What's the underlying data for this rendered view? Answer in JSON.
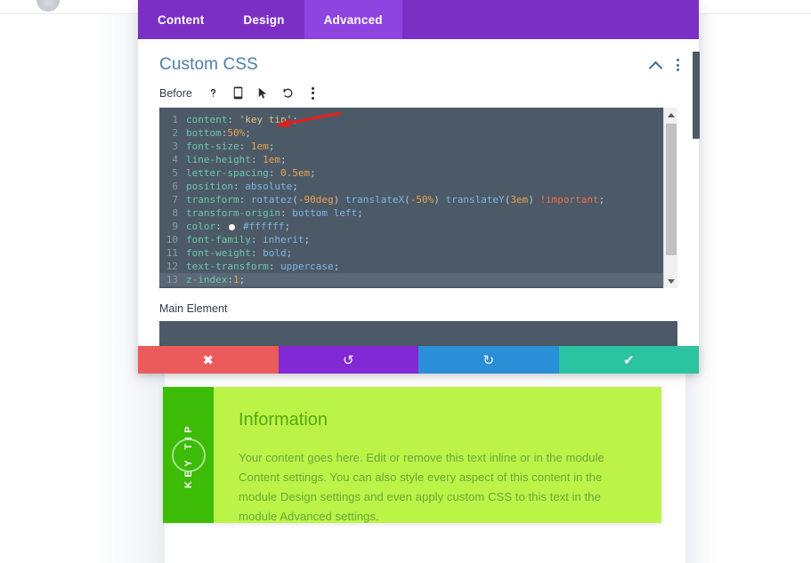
{
  "panel": {
    "tabs": [
      {
        "label": "Content",
        "active": false
      },
      {
        "label": "Design",
        "active": false
      },
      {
        "label": "Advanced",
        "active": true
      }
    ],
    "section_title": "Custom CSS",
    "collapse_icon": "chevron-up-icon",
    "menu_icon": "kebab-menu-icon"
  },
  "toolbar": {
    "label": "Before",
    "icons": [
      {
        "name": "help-icon",
        "glyph": "?"
      },
      {
        "name": "device-mobile-icon",
        "glyph": "⎕"
      },
      {
        "name": "cursor-pointer-icon",
        "glyph": "↖"
      },
      {
        "name": "reset-undo-icon",
        "glyph": "↺"
      },
      {
        "name": "kebab-menu-icon",
        "glyph": "⋮"
      }
    ]
  },
  "editor": {
    "lines": [
      {
        "n": "1",
        "segments": [
          {
            "t": "prop",
            "v": "content"
          },
          {
            "t": "punc",
            "v": ": "
          },
          {
            "t": "str",
            "v": "'key tip'"
          },
          {
            "t": "punc",
            "v": ";"
          }
        ]
      },
      {
        "n": "2",
        "segments": [
          {
            "t": "prop",
            "v": "bottom"
          },
          {
            "t": "punc",
            "v": ":"
          },
          {
            "t": "num",
            "v": "50%"
          },
          {
            "t": "punc",
            "v": ";"
          }
        ]
      },
      {
        "n": "3",
        "segments": [
          {
            "t": "prop",
            "v": "font-size"
          },
          {
            "t": "punc",
            "v": ": "
          },
          {
            "t": "num",
            "v": "1em"
          },
          {
            "t": "punc",
            "v": ";"
          }
        ]
      },
      {
        "n": "4",
        "segments": [
          {
            "t": "prop",
            "v": "line-height"
          },
          {
            "t": "punc",
            "v": ": "
          },
          {
            "t": "num",
            "v": "1em"
          },
          {
            "t": "punc",
            "v": ";"
          }
        ]
      },
      {
        "n": "5",
        "segments": [
          {
            "t": "prop",
            "v": "letter-spacing"
          },
          {
            "t": "punc",
            "v": ": "
          },
          {
            "t": "num",
            "v": "0.5em"
          },
          {
            "t": "punc",
            "v": ";"
          }
        ]
      },
      {
        "n": "6",
        "segments": [
          {
            "t": "prop",
            "v": "position"
          },
          {
            "t": "punc",
            "v": ": "
          },
          {
            "t": "val",
            "v": "absolute"
          },
          {
            "t": "punc",
            "v": ";"
          }
        ]
      },
      {
        "n": "7",
        "segments": [
          {
            "t": "prop",
            "v": "transform"
          },
          {
            "t": "punc",
            "v": ": "
          },
          {
            "t": "func",
            "v": "rotatez"
          },
          {
            "t": "punc",
            "v": "("
          },
          {
            "t": "num",
            "v": "-90deg"
          },
          {
            "t": "punc",
            "v": ") "
          },
          {
            "t": "func",
            "v": "translateX"
          },
          {
            "t": "punc",
            "v": "("
          },
          {
            "t": "num",
            "v": "-50%"
          },
          {
            "t": "punc",
            "v": ") "
          },
          {
            "t": "func",
            "v": "translateY"
          },
          {
            "t": "punc",
            "v": "("
          },
          {
            "t": "num",
            "v": "3em"
          },
          {
            "t": "punc",
            "v": ") "
          },
          {
            "t": "imp",
            "v": "!important"
          },
          {
            "t": "punc",
            "v": ";"
          }
        ]
      },
      {
        "n": "8",
        "segments": [
          {
            "t": "prop",
            "v": "transform-origin"
          },
          {
            "t": "punc",
            "v": ": "
          },
          {
            "t": "val",
            "v": "bottom left"
          },
          {
            "t": "punc",
            "v": ";"
          }
        ]
      },
      {
        "n": "9",
        "segments": [
          {
            "t": "prop",
            "v": "color"
          },
          {
            "t": "punc",
            "v": ": "
          },
          {
            "t": "swatch",
            "v": ""
          },
          {
            "t": "val",
            "v": "#ffffff"
          },
          {
            "t": "punc",
            "v": ";"
          }
        ]
      },
      {
        "n": "10",
        "segments": [
          {
            "t": "prop",
            "v": "font-family"
          },
          {
            "t": "punc",
            "v": ": "
          },
          {
            "t": "val",
            "v": "inherit"
          },
          {
            "t": "punc",
            "v": ";"
          }
        ]
      },
      {
        "n": "11",
        "segments": [
          {
            "t": "prop",
            "v": "font-weight"
          },
          {
            "t": "punc",
            "v": ": "
          },
          {
            "t": "val",
            "v": "bold"
          },
          {
            "t": "punc",
            "v": ";"
          }
        ]
      },
      {
        "n": "12",
        "segments": [
          {
            "t": "prop",
            "v": "text-transform"
          },
          {
            "t": "punc",
            "v": ": "
          },
          {
            "t": "val",
            "v": "uppercase"
          },
          {
            "t": "punc",
            "v": ";"
          }
        ]
      },
      {
        "n": "13",
        "active": true,
        "segments": [
          {
            "t": "prop",
            "v": "z-index"
          },
          {
            "t": "punc",
            "v": ":"
          },
          {
            "t": "num",
            "v": "1"
          },
          {
            "t": "punc",
            "v": ";"
          }
        ]
      }
    ],
    "annotation": {
      "name": "red-arrow-annotation",
      "color": "#e02020"
    }
  },
  "main_element": {
    "label": "Main Element",
    "value": ""
  },
  "actions": [
    {
      "name": "cancel-button",
      "glyph": "✖",
      "color": "#ec5b5b"
    },
    {
      "name": "undo-button",
      "glyph": "↺",
      "color": "#8029d4"
    },
    {
      "name": "redo-button",
      "glyph": "↻",
      "color": "#2b8fd8"
    },
    {
      "name": "save-button",
      "glyph": "✔",
      "color": "#2bc4a0"
    }
  ],
  "info_module": {
    "side_text": "KEY TIP",
    "icon": "info-circle-icon",
    "title": "Information",
    "body": "Your content goes here. Edit or remove this text inline or in the module Content settings. You can also style every aspect of this content in the module Design settings and even apply custom CSS to this text in the module Advanced settings.",
    "side_color": "#3cbc06",
    "body_color": "#bbf447",
    "title_color": "#55a913"
  }
}
